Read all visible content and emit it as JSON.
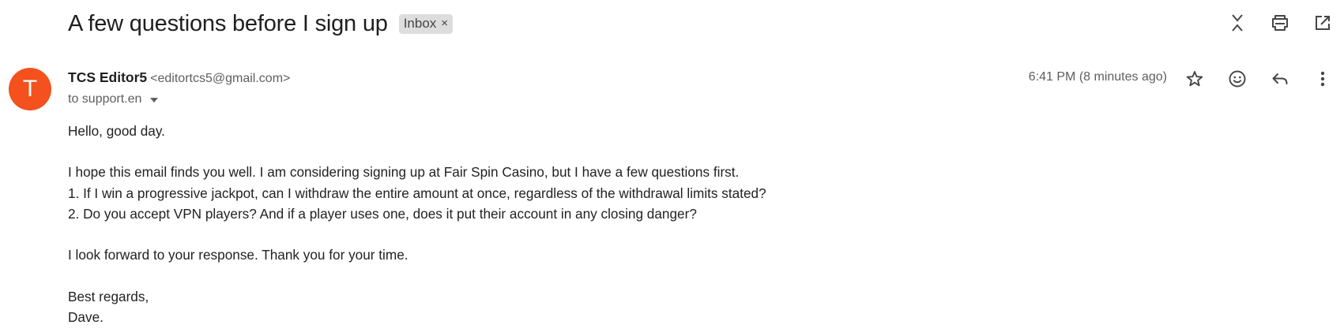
{
  "email": {
    "subject": "A few questions before I sign up",
    "label": "Inbox",
    "label_remove": "×",
    "sender": {
      "name": "TCS Editor5",
      "email": "<editortcs5@gmail.com>",
      "avatar_letter": "T",
      "avatar_color": "#f4511e"
    },
    "recipient_line": "to support.en",
    "time": "6:41 PM (8 minutes ago)",
    "body": {
      "greeting": "Hello, good day.",
      "line1": "I hope this email finds you well. I am considering signing up at Fair Spin Casino, but I have a few questions first.",
      "line2": "1. If I win a progressive jackpot, can I withdraw the entire amount at once, regardless of the withdrawal limits stated?",
      "line3": "2. Do you accept VPN players? And if a player uses one, does it put their account in any closing danger?",
      "line4": "I look forward to your response. Thank you for your time.",
      "closing": "Best regards,",
      "signature": "Dave."
    }
  },
  "icons": {
    "top": [
      "collapse-all-icon",
      "print-icon",
      "open-in-new-window-icon"
    ],
    "message": [
      "star-icon",
      "emoji-reaction-icon",
      "reply-icon",
      "more-options-icon"
    ]
  },
  "colors": {
    "text": "#1f1f1f",
    "muted": "#5e5e5e",
    "chip_bg": "#dddddd",
    "icon": "#444746"
  }
}
